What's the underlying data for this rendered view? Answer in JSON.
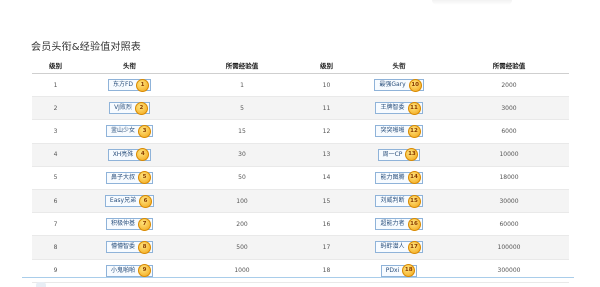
{
  "page": {
    "title": "会员头衔&经验值对照表"
  },
  "table": {
    "headers": [
      "级别",
      "头衔",
      "所需经验值",
      "级别",
      "头衔",
      "所需经验值"
    ],
    "rows": [
      [
        {
          "level": "1",
          "title": "东方FD",
          "badge": "1",
          "exp": "1"
        },
        {
          "level": "10",
          "title": "最强Gary",
          "badge": "10",
          "exp": "2000"
        }
      ],
      [
        {
          "level": "2",
          "title": "VJ败烈",
          "badge": "2",
          "exp": "5"
        },
        {
          "level": "11",
          "title": "王牌智委",
          "badge": "11",
          "exp": "3000"
        }
      ],
      [
        {
          "level": "3",
          "title": "釜山少女",
          "badge": "3",
          "exp": "15"
        },
        {
          "level": "12",
          "title": "突突啪啪",
          "badge": "12",
          "exp": "6000"
        }
      ],
      [
        {
          "level": "4",
          "title": "XH亮殊",
          "badge": "4",
          "exp": "30"
        },
        {
          "level": "13",
          "title": "周一CP",
          "badge": "13",
          "exp": "10000"
        }
      ],
      [
        {
          "level": "5",
          "title": "鼻子大叔",
          "badge": "5",
          "exp": "50"
        },
        {
          "level": "14",
          "title": "能力图腾",
          "badge": "14",
          "exp": "18000"
        }
      ],
      [
        {
          "level": "6",
          "title": "Easy兄弟",
          "badge": "6",
          "exp": "100"
        },
        {
          "level": "15",
          "title": "刘威判断",
          "badge": "15",
          "exp": "30000"
        }
      ],
      [
        {
          "level": "7",
          "title": "积极仲基",
          "badge": "7",
          "exp": "200"
        },
        {
          "level": "16",
          "title": "超能力者",
          "badge": "16",
          "exp": "60000"
        }
      ],
      [
        {
          "level": "8",
          "title": "懵懵智委",
          "badge": "8",
          "exp": "500"
        },
        {
          "level": "17",
          "title": "蚂蚱潜人",
          "badge": "17",
          "exp": "100000"
        }
      ],
      [
        {
          "level": "9",
          "title": "小鬼啪啪",
          "badge": "9",
          "exp": "1000"
        },
        {
          "level": "18",
          "title": "PDxi",
          "badge": "18",
          "exp": "300000"
        }
      ]
    ]
  },
  "colors": {
    "badge_fill": "#f2a417",
    "tag_border": "#8fb3d9",
    "row_alt": "#f4f4f4",
    "rule": "#a9cdea"
  }
}
